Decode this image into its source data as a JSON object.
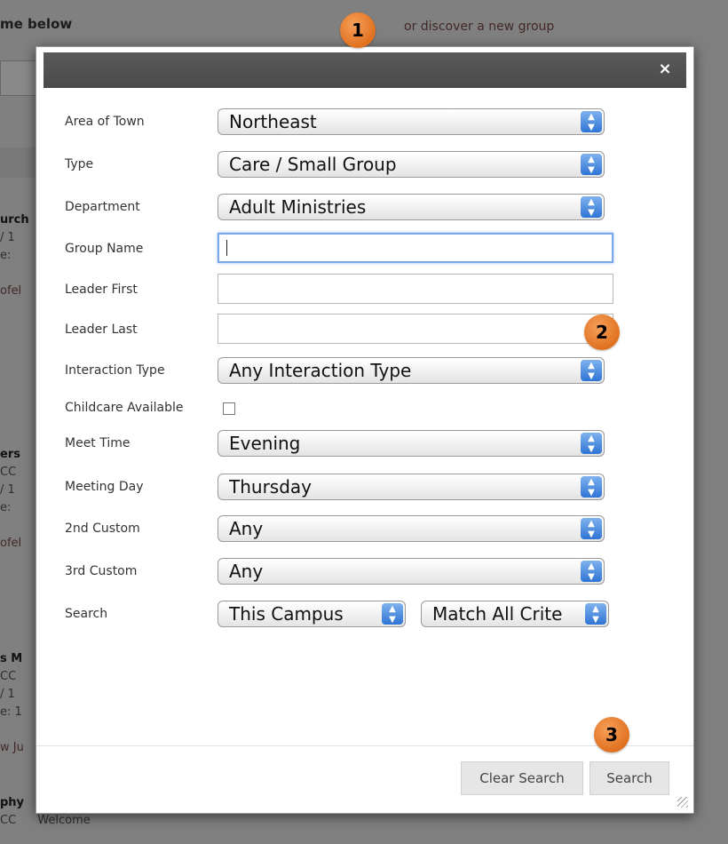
{
  "background_page": {
    "header_text": "me below",
    "discover_link": "or discover a new group",
    "items": [
      {
        "title": "urch",
        "line1": "/ 1",
        "line2": "e:",
        "link": "ofel"
      },
      {
        "title": "ers",
        "line1": "CC",
        "line2": "/ 1",
        "line3": "e:",
        "link": "ofel"
      },
      {
        "title": "s M",
        "line1": "CC",
        "line2": "/ 1",
        "line3": "e: 1",
        "link": "w Ju"
      },
      {
        "title": "phy",
        "line1": "CC",
        "line2": "Welcome"
      }
    ]
  },
  "badges": {
    "one": "1",
    "two": "2",
    "three": "3"
  },
  "modal": {
    "close_icon": "×",
    "fields": {
      "area_of_town": {
        "label": "Area of Town",
        "value": "Northeast"
      },
      "type": {
        "label": "Type",
        "value": "Care / Small Group"
      },
      "department": {
        "label": "Department",
        "value": "Adult Ministries"
      },
      "group_name": {
        "label": "Group Name",
        "value": ""
      },
      "leader_first": {
        "label": "Leader First",
        "value": ""
      },
      "leader_last": {
        "label": "Leader Last",
        "value": ""
      },
      "interaction_type": {
        "label": "Interaction Type",
        "value": "Any Interaction Type"
      },
      "childcare": {
        "label": "Childcare Available",
        "checked": false
      },
      "meet_time": {
        "label": "Meet Time",
        "value": "Evening"
      },
      "meeting_day": {
        "label": "Meeting Day",
        "value": "Thursday"
      },
      "custom_2": {
        "label": "2nd Custom",
        "value": "Any"
      },
      "custom_3": {
        "label": "3rd Custom",
        "value": "Any"
      },
      "search": {
        "label": "Search",
        "scope_value": "This Campus",
        "match_value": "Match All Crite"
      }
    },
    "buttons": {
      "clear": "Clear Search",
      "search": "Search"
    }
  },
  "colors": {
    "badge": "#e8822f",
    "titlebar": "#4f4f4f",
    "select_arrow": "#3a7fe0"
  }
}
